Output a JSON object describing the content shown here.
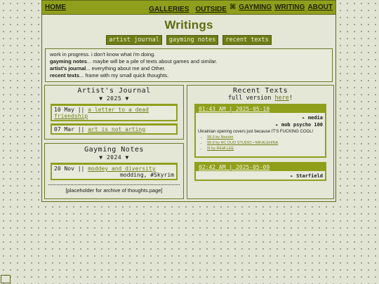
{
  "nav": {
    "home": "HOME",
    "galleries": "GALLERIES",
    "outside": "OUTSIDE",
    "symbol": "⌘",
    "gayming": "GAYMING",
    "writing": "WRITING",
    "about": "ABOUT"
  },
  "page_title": "Writings",
  "tabs": [
    "artist journal",
    "gayming notes",
    "recent texts"
  ],
  "intro": {
    "line1": "work in progress. i don't know what i'm doing.",
    "l2_label": "gayming notes",
    "l2_text": "... maybe will be a pile of texts about games and similar.",
    "l3_label": "artist's journal",
    "l3_text": "... everything about me and Other.",
    "l4_label": "recent texts",
    "l4_text": "... frame with my small quick thoughts."
  },
  "artists_journal": {
    "title": "Artist's Journal",
    "year": "▼ 2025 ▼",
    "entries": [
      {
        "date": "10 May ||",
        "title": "a letter to a dead friendship"
      },
      {
        "date": "07 Mar ||",
        "title": "art is not arting"
      }
    ]
  },
  "gayming_notes": {
    "title": "Gayming Notes",
    "year": "▼ 2024 ▼",
    "entries": [
      {
        "date": "20 Nov ||",
        "title": "moddey and diversity",
        "tags": "modding, #Skyrim"
      }
    ],
    "placeholder": "[placeholder for archive of thoughts.page]"
  },
  "recent_texts": {
    "title": "Recent Texts",
    "full_prefix": "full version ",
    "full_link": "here",
    "full_suffix": "!",
    "posts": [
      {
        "timestamp": "01:43 AM | 2025-05-10",
        "tag1": "▸ media",
        "tag2": "▸ mob psycho 100",
        "body": "Ukrainian opening covers just because IT'S FUCKING COOL!",
        "links": [
          "99.9 by Noerim",
          "99.9 by RC DUO STUDIO • NIKALEHINA",
          "III by RIHA LEE"
        ]
      },
      {
        "timestamp": "02:42 AM | 2025-05-09",
        "tag1": "▸ Starfield"
      }
    ]
  },
  "corner_icon": "^",
  "colors": {
    "accent": "#8f9f1c",
    "dark_accent": "#6e7d16",
    "background": "#e2e4d3"
  }
}
